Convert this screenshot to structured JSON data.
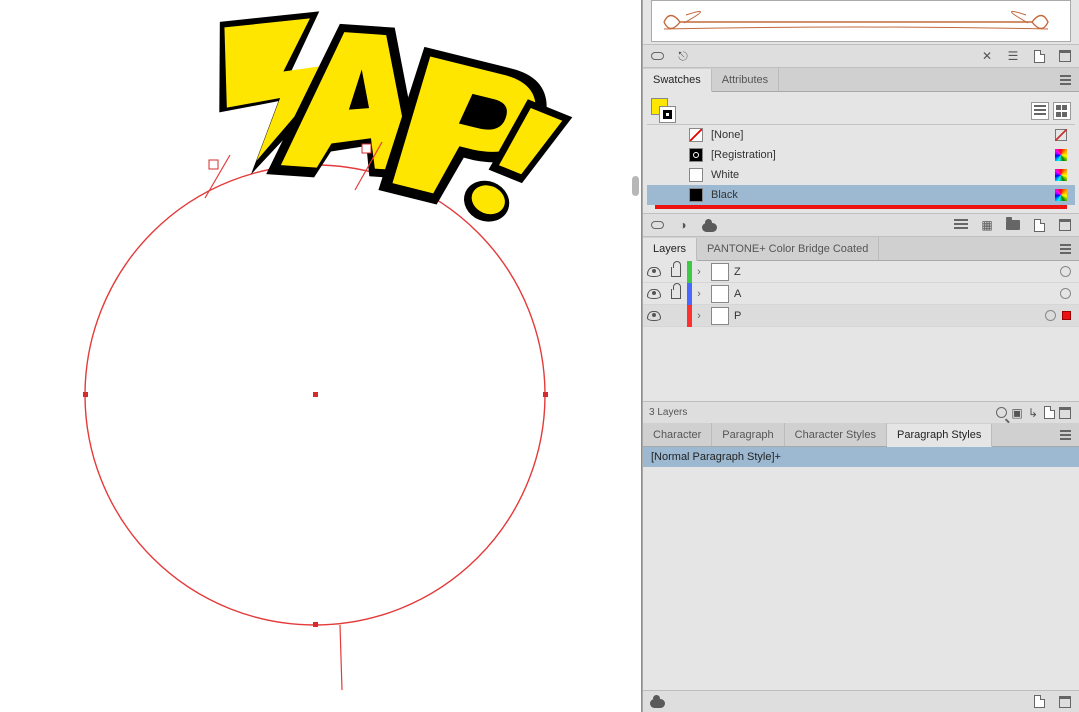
{
  "canvas": {
    "zap_text": "ZAP!",
    "zap_fill": "#ffe600",
    "zap_stroke": "#000000",
    "circle_stroke": "#e43a3a"
  },
  "top_preview": {
    "stroke": "#c4683d"
  },
  "swatches_panel": {
    "tab_swatches": "Swatches",
    "tab_attributes": "Attributes",
    "fill_color": "#ffe600",
    "items": [
      {
        "name": "[None]",
        "chip": "none",
        "icon": "noedit"
      },
      {
        "name": "[Registration]",
        "chip": "reg",
        "icon": "rainbow"
      },
      {
        "name": "White",
        "chip": "#ffffff",
        "icon": "rainbow"
      },
      {
        "name": "Black",
        "chip": "#000000",
        "icon": "rainbow",
        "selected": true
      }
    ]
  },
  "layers_panel": {
    "tab_layers": "Layers",
    "tab_pantone": "PANTONE+ Color Bridge Coated",
    "layers": [
      {
        "name": "Z",
        "color": "#3ec945",
        "locked": true
      },
      {
        "name": "A",
        "color": "#4a68ff",
        "locked": true
      },
      {
        "name": "P",
        "color": "#ff3030",
        "locked": false,
        "selected": true,
        "has_sel_ind": true
      }
    ],
    "footer_count": "3 Layers"
  },
  "type_panel": {
    "tab_character": "Character",
    "tab_paragraph": "Paragraph",
    "tab_char_styles": "Character Styles",
    "tab_para_styles": "Paragraph Styles",
    "styles": [
      {
        "name": "[Normal Paragraph Style]+",
        "selected": true
      }
    ]
  }
}
